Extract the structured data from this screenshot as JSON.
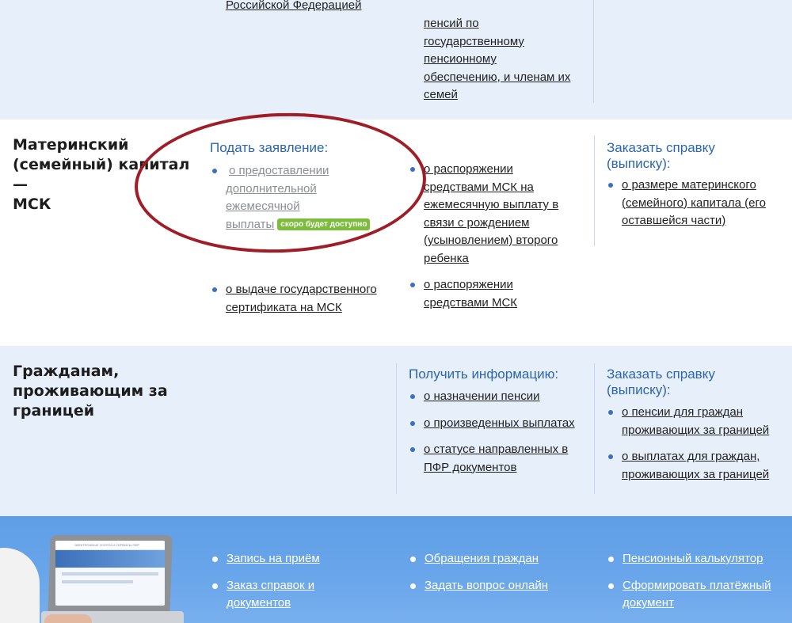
{
  "top_section": {
    "left_link": "Российской Федерацией",
    "mid_link_lines": [
      "пенсий по",
      "государственному",
      "пенсионному",
      "обеспечению, и членам их",
      "семей"
    ]
  },
  "msk_section": {
    "title_lines": [
      "Материнский",
      "(семейный) капитал —",
      "МСК"
    ],
    "apply_heading": "Подать заявление:",
    "col1_items": [
      {
        "lines": [
          "о предоставлении",
          "дополнительной",
          "ежемесячной",
          "выплаты"
        ],
        "badge": "скоро будет доступно"
      },
      {
        "lines": [
          "о выдаче государственного",
          "сертификата на МСК"
        ]
      }
    ],
    "col2_items": [
      {
        "lines": [
          "о распоряжении",
          "средствами МСК на",
          "ежемесячную выплату в",
          "связи с рождением",
          "(усыновлением) второго",
          "ребенка"
        ]
      },
      {
        "lines": [
          "о распоряжении",
          "средствами МСК"
        ]
      }
    ],
    "order_heading_lines": [
      "Заказать справку",
      "(выписку):"
    ],
    "col3_items": [
      {
        "lines": [
          "о размере материнского",
          "(семейного) капитала (его",
          "оставшейся части)"
        ]
      }
    ]
  },
  "abroad_section": {
    "title_lines": [
      "Гражданам,",
      "проживающим за",
      "границей"
    ],
    "info_heading": "Получить информацию:",
    "info_items": [
      {
        "lines": [
          "о назначении пенсии"
        ]
      },
      {
        "lines": [
          "о произведенных выплатах"
        ]
      },
      {
        "lines": [
          "о статусе направленных в",
          "ПФР документов"
        ]
      }
    ],
    "order_heading_lines": [
      "Заказать справку",
      "(выписку):"
    ],
    "order_items": [
      {
        "lines": [
          "о пенсии для граждан",
          "проживающих за границей"
        ]
      },
      {
        "lines": [
          "о выплатах для граждан,",
          "проживающих за границей"
        ]
      }
    ]
  },
  "footer": {
    "col1": [
      {
        "lines": [
          "Запись на приём"
        ]
      },
      {
        "lines": [
          "Заказ справок и",
          "документов"
        ]
      }
    ],
    "col2": [
      {
        "lines": [
          "Обращения граждан"
        ]
      },
      {
        "lines": [
          "Задать вопрос онлайн"
        ]
      }
    ],
    "col3": [
      {
        "lines": [
          "Пенсионный калькулятор"
        ]
      },
      {
        "lines": [
          "Сформировать платёжный",
          "документ"
        ]
      }
    ],
    "laptop_screen_title": "ЭЛЕКТРОННЫЕ УСЛУГИ И СЕРВИСЫ ПФР"
  },
  "colors": {
    "light_band": "#e7effb",
    "accent_blue": "#2b66b0",
    "bullet_blue": "#3a70c2",
    "badge_green": "#7cbe3c",
    "annotation_red": "#a01c26",
    "footer_blue": "#5f9ee6"
  }
}
